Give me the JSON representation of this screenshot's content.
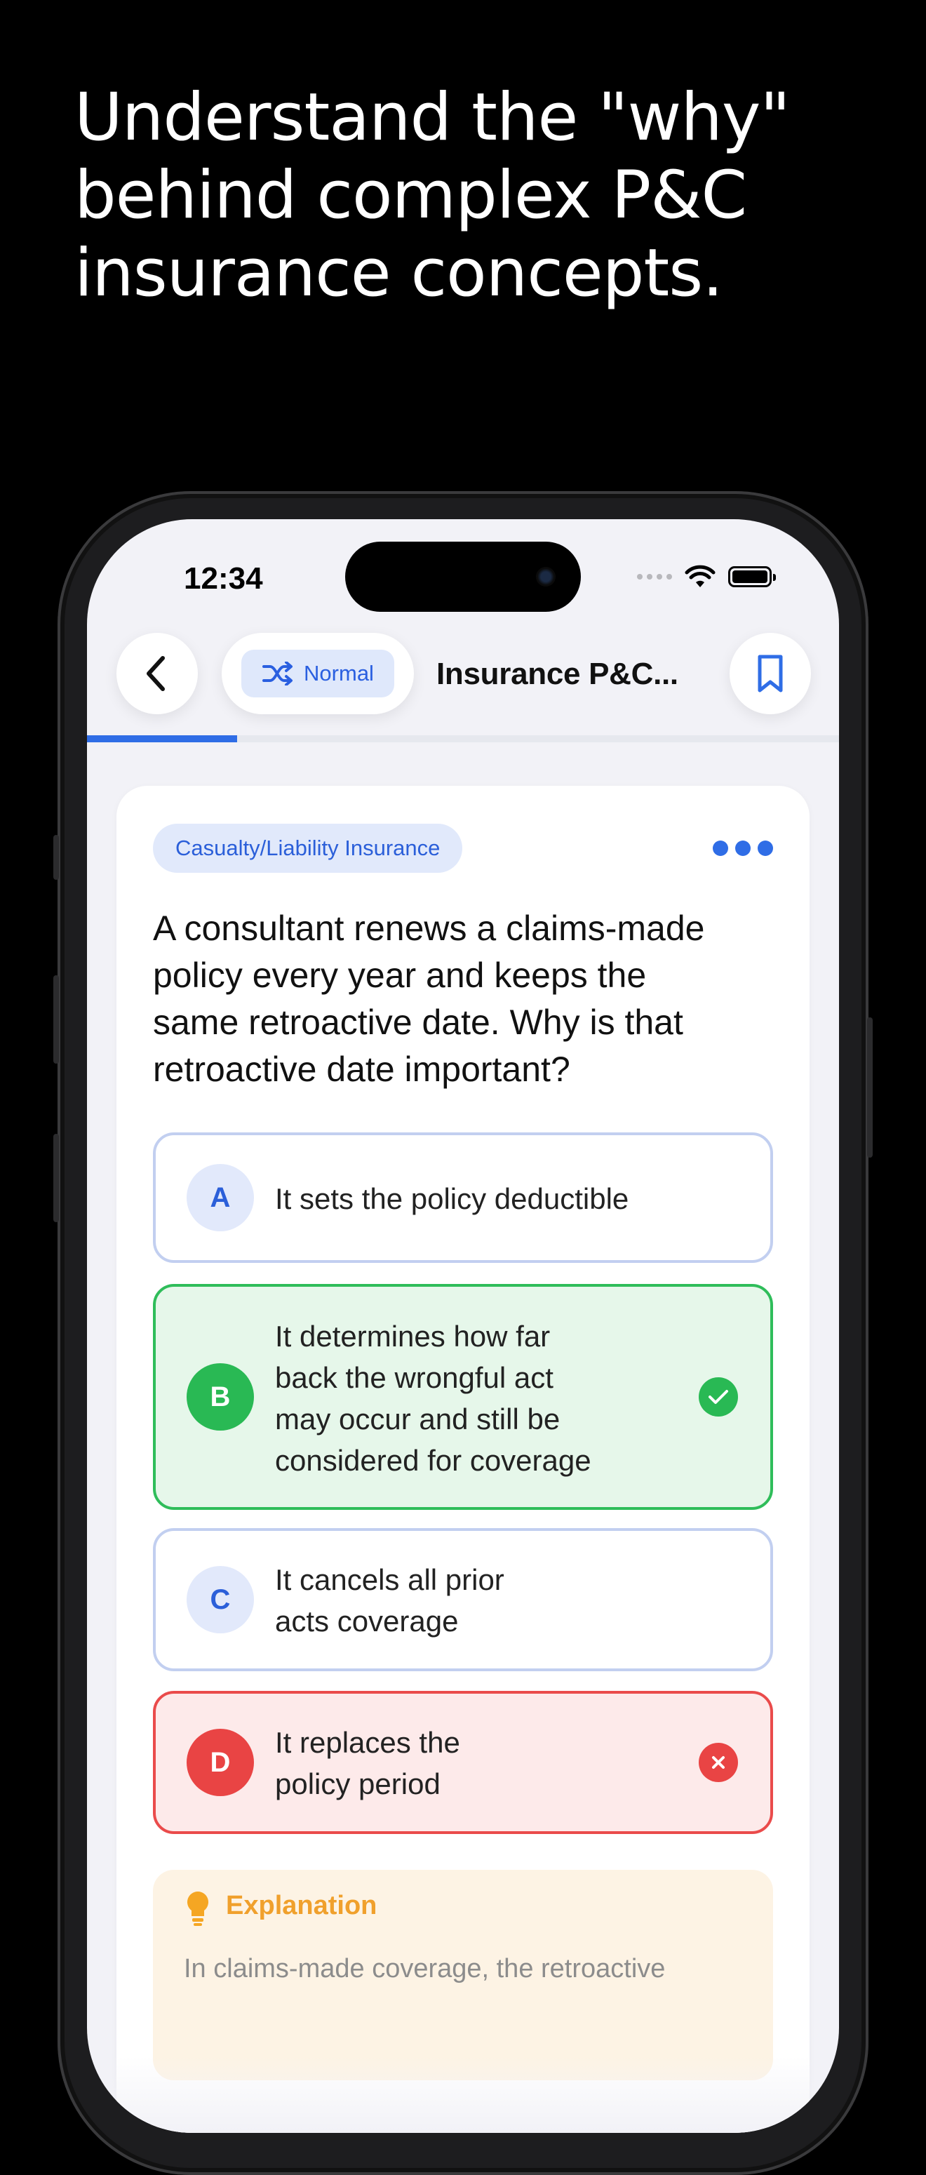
{
  "headline": {
    "lines": [
      "Understand the \"why\"",
      "behind complex P&C",
      "insurance concepts."
    ]
  },
  "status_bar": {
    "time": "12:34"
  },
  "nav": {
    "mode_label": "Normal",
    "title": "Insurance P&C..."
  },
  "progress": {
    "fraction": 0.2
  },
  "question_card": {
    "category": "Casualty/Liability Insurance",
    "question_lines": [
      "A consultant renews a claims-made",
      "policy every year and keeps the",
      "same retroactive date. Why is that",
      "retroactive date important?"
    ],
    "options": [
      {
        "letter": "A",
        "lines": [
          "It sets the policy deductible"
        ],
        "state": "default"
      },
      {
        "letter": "B",
        "lines": [
          "It determines how far",
          "back the wrongful act",
          "may occur and still be",
          "considered for coverage"
        ],
        "state": "correct"
      },
      {
        "letter": "C",
        "lines": [
          "It cancels all prior",
          "acts coverage"
        ],
        "state": "default"
      },
      {
        "letter": "D",
        "lines": [
          "It replaces the",
          "policy period"
        ],
        "state": "wrong"
      }
    ],
    "explanation": {
      "title": "Explanation",
      "lines": [
        "In claims-made coverage, the retroactive"
      ]
    }
  },
  "colors": {
    "accent": "#2f6de6",
    "correct": "#29b954",
    "wrong": "#e94444",
    "explanation": "#f0a02c"
  }
}
